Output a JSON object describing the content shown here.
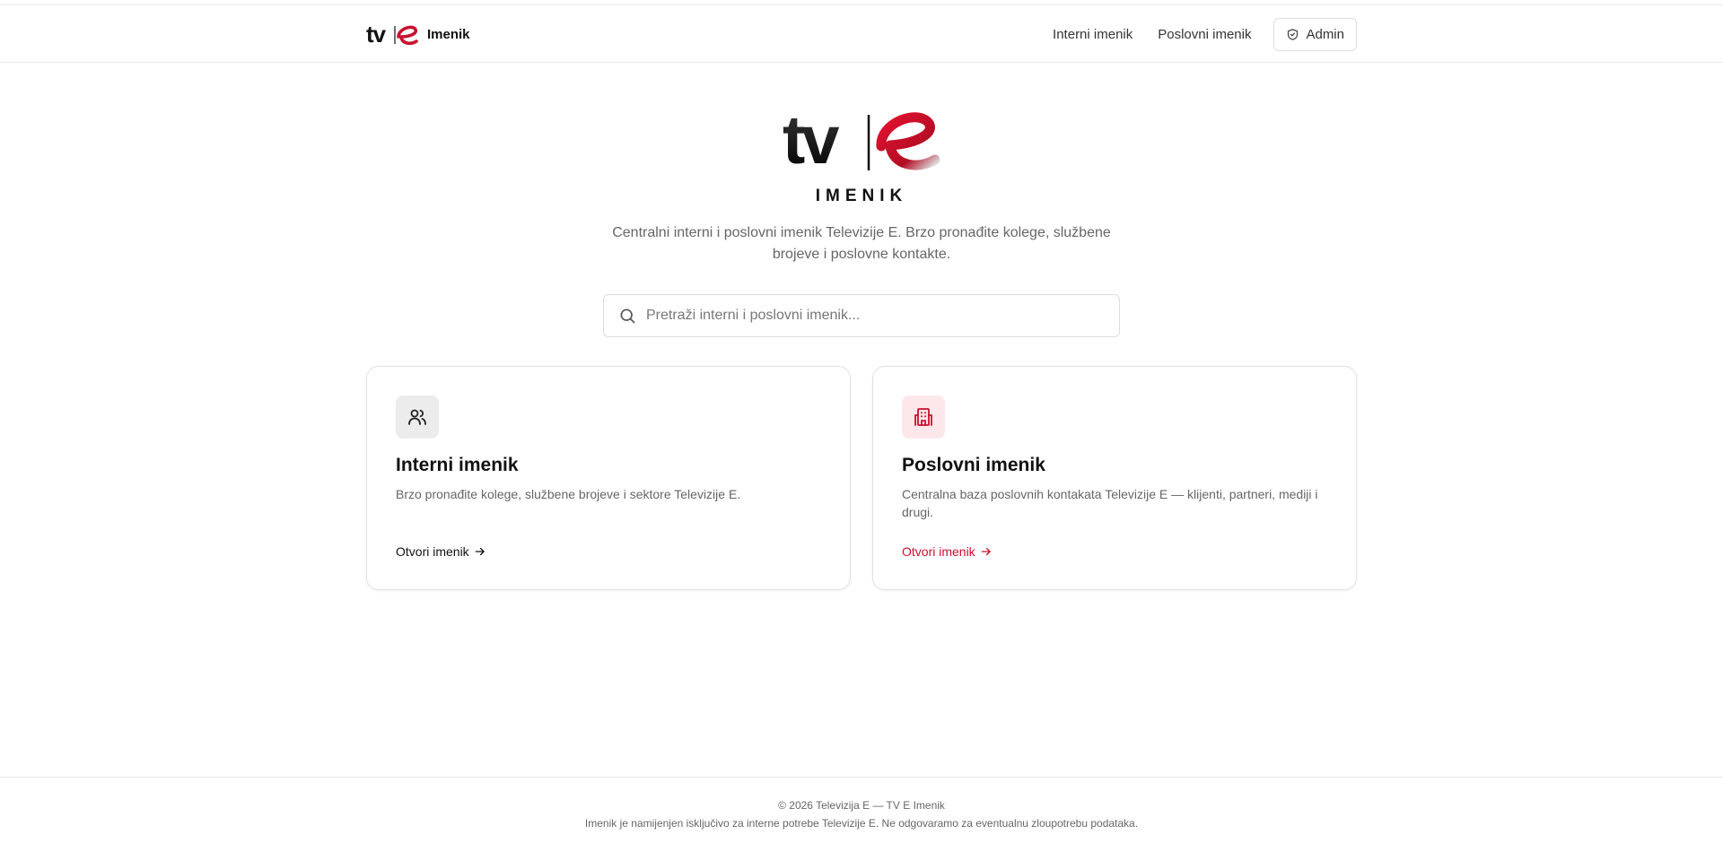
{
  "header": {
    "brand_logo_text": "tv|e",
    "brand_text": "Imenik",
    "nav": {
      "internal_label": "Interni imenik",
      "business_label": "Poslovni imenik",
      "admin_label": "Admin"
    }
  },
  "hero": {
    "logo_text": "tv|e",
    "title": "IMENIK",
    "description": "Centralni interni i poslovni imenik Televizije E. Brzo pronađite kolege, službene brojeve i poslovne kontakte."
  },
  "search": {
    "placeholder": "Pretraži interni i poslovni imenik...",
    "value": ""
  },
  "cards": [
    {
      "icon": "users-icon",
      "title": "Interni imenik",
      "description": "Brzo pronađite kolege, službene brojeve i sektore Televizije E.",
      "link_label": "Otvori imenik"
    },
    {
      "icon": "building-icon",
      "title": "Poslovni imenik",
      "description": "Centralna baza poslovnih kontakata Televizije E — klijenti, partneri, mediji i drugi.",
      "link_label": "Otvori imenik"
    }
  ],
  "footer": {
    "copyright": "© 2026 Televizija E — TV E Imenik",
    "note": "Imenik je namijenjen isključivo za interne potrebe Televizije E. Ne odgovaramo za eventualnu zloupotrebu podataka."
  },
  "colors": {
    "accent": "#c8102e",
    "accent_soft": "#fde7ea",
    "text": "#111111",
    "muted": "#666666",
    "border": "#e2e2e2"
  }
}
